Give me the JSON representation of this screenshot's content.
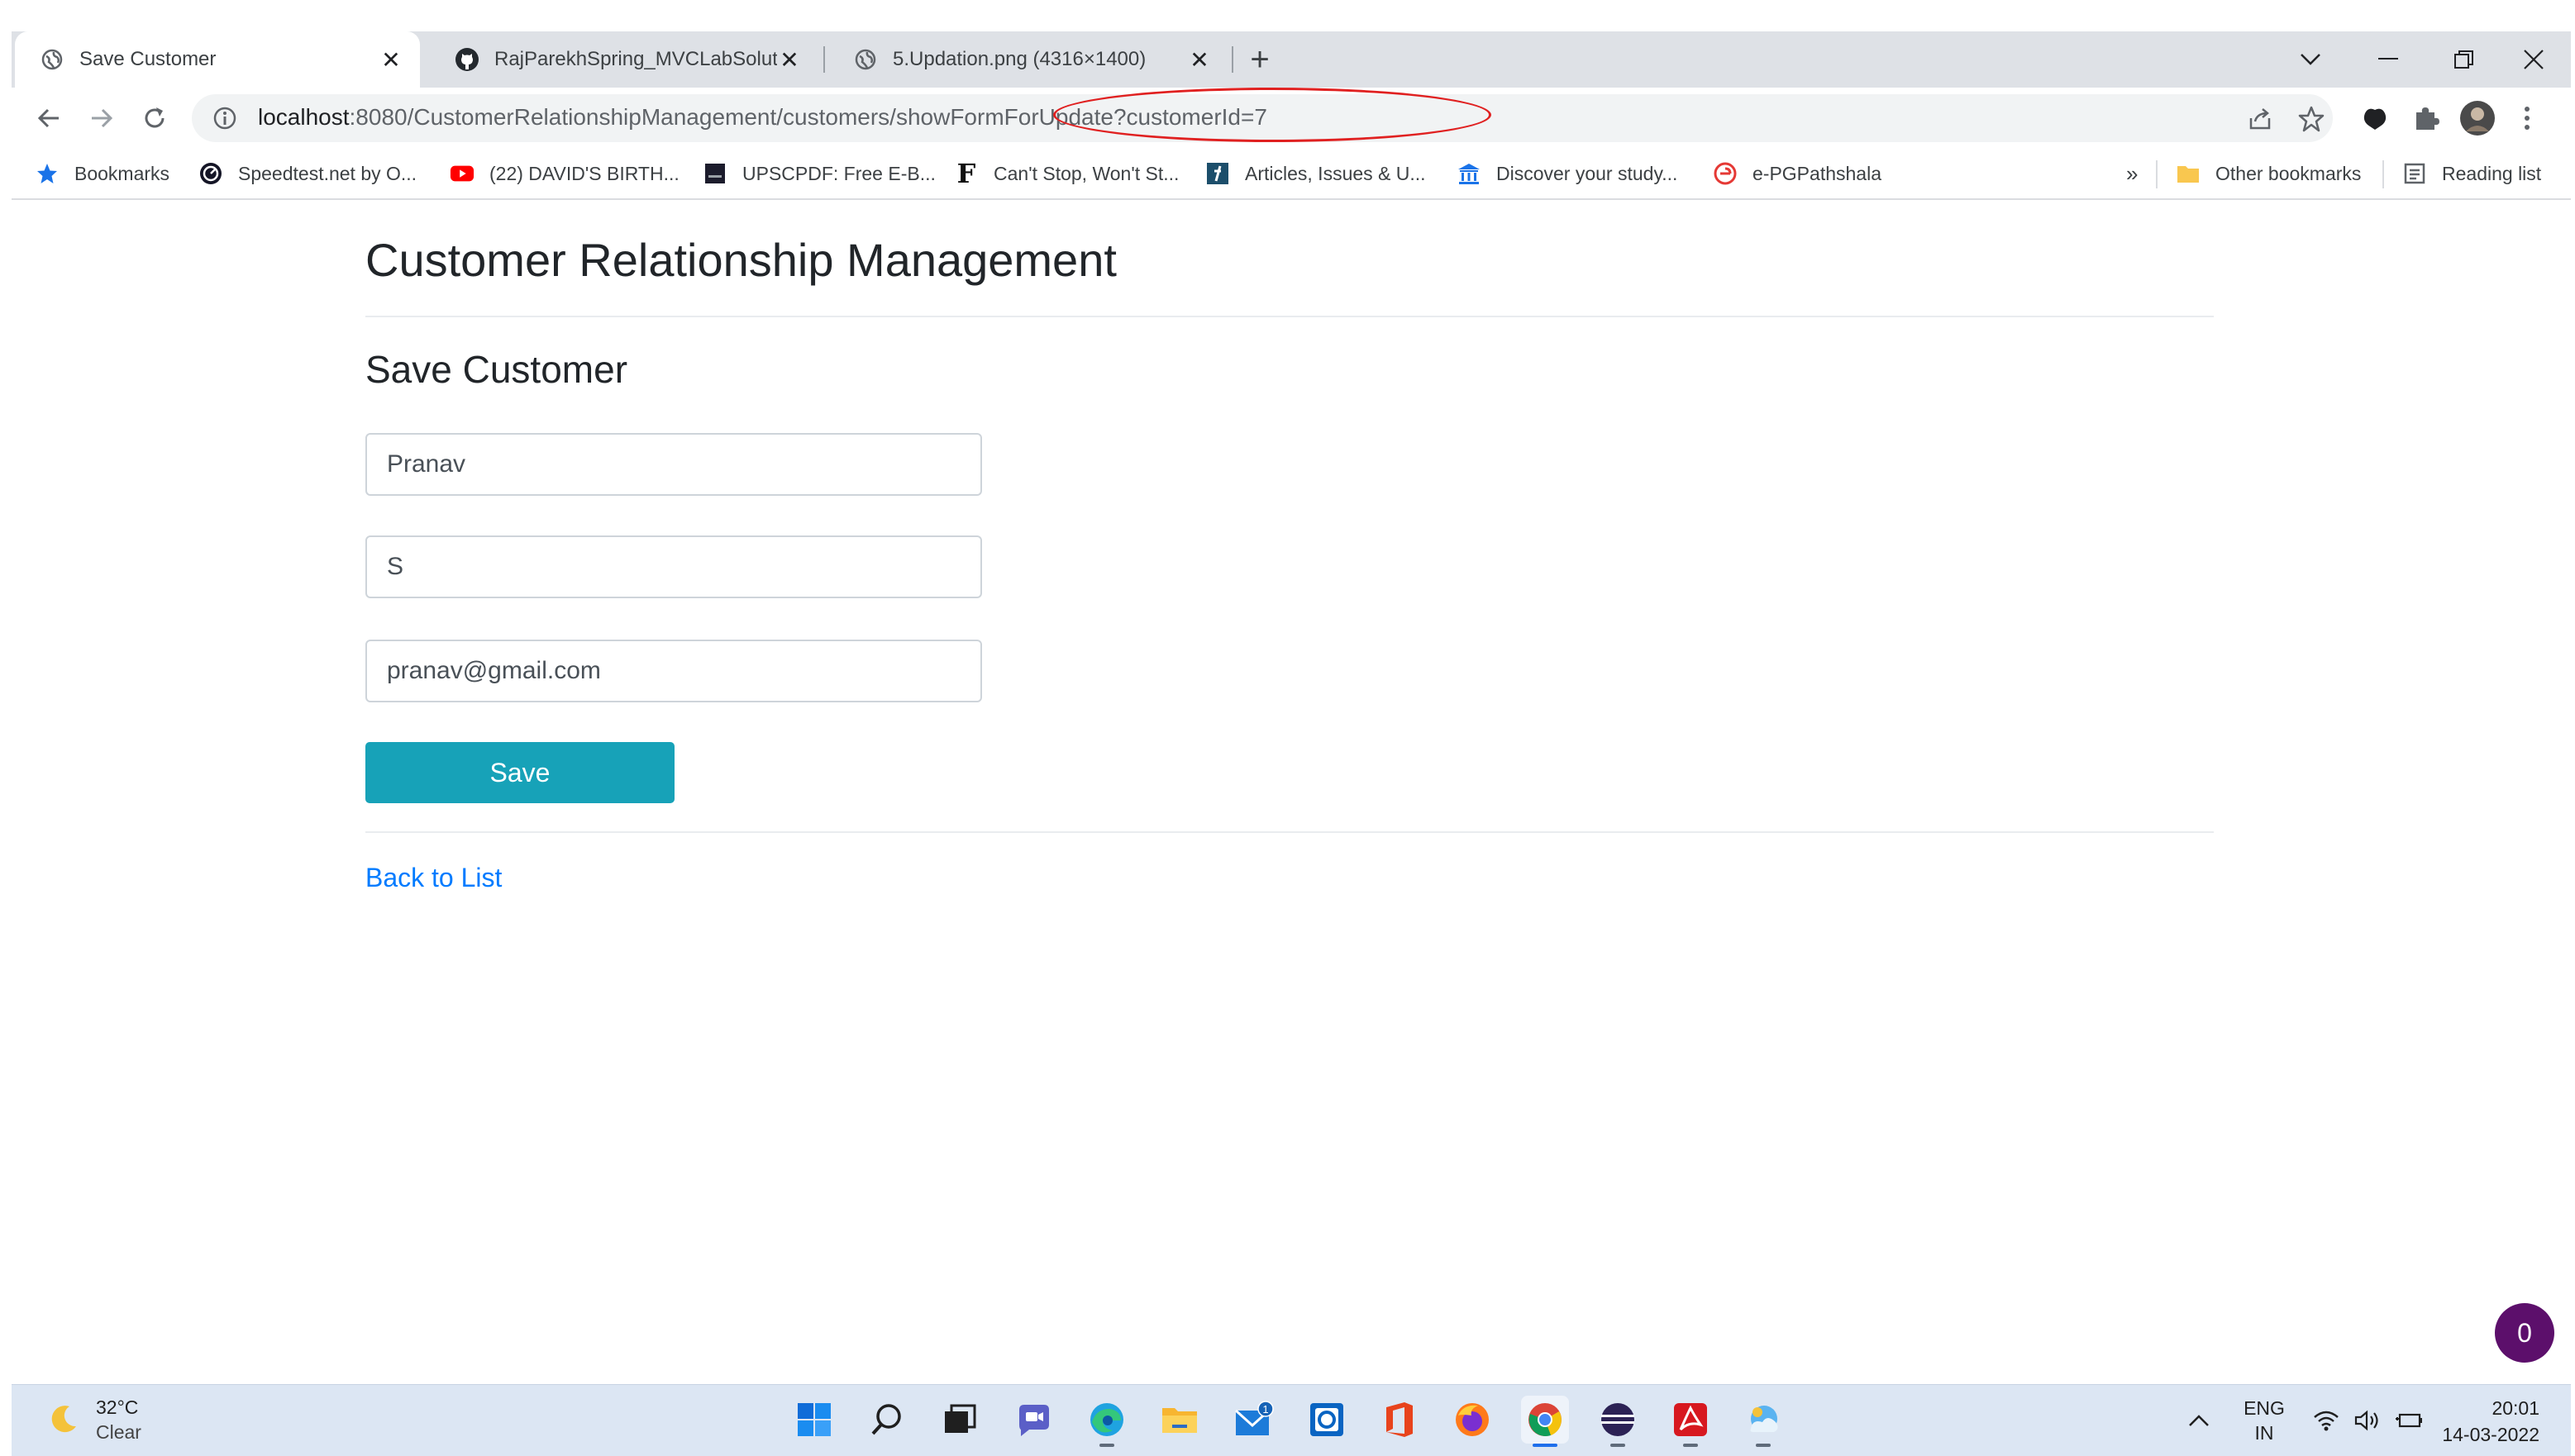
{
  "browser": {
    "tabs": [
      {
        "title": "Save Customer",
        "favicon": "globe-icon",
        "active": true
      },
      {
        "title": "RajParekhSpring_MVCLabSolutio",
        "favicon": "github-icon",
        "active": false
      },
      {
        "title": "5.Updation.png (4316×1400)",
        "favicon": "globe-icon",
        "active": false
      }
    ],
    "url_host": "localhost",
    "url_path": ":8080/CustomerRelationshipManagement/customers/showFormForUpdate?customerId=7",
    "bookmarks": [
      {
        "label": "Bookmarks",
        "icon": "star-icon"
      },
      {
        "label": "Speedtest.net by O...",
        "icon": "speedtest-icon"
      },
      {
        "label": "(22) DAVID'S BIRTH...",
        "icon": "youtube-icon"
      },
      {
        "label": "UPSCPDF: Free E-B...",
        "icon": "upscpdf-icon"
      },
      {
        "label": "Can't Stop, Won't St...",
        "icon": "f-letter-icon"
      },
      {
        "label": "Articles, Issues & U...",
        "icon": "journal-icon"
      },
      {
        "label": "Discover your study...",
        "icon": "institution-icon"
      },
      {
        "label": "e-PGPathshala",
        "icon": "epg-icon"
      }
    ],
    "bookmarks_overflow": "»",
    "other_bookmarks": "Other bookmarks",
    "reading_list": "Reading list",
    "accent_color": "#17a2b8"
  },
  "page": {
    "title": "Customer Relationship Management",
    "subtitle": "Save Customer",
    "form": {
      "first_name": "Pranav",
      "last_name": "S",
      "email": "pranav@gmail.com",
      "save_label": "Save"
    },
    "back_link": "Back to List",
    "badge_count": "0"
  },
  "taskbar": {
    "weather_temp": "32°C",
    "weather_desc": "Clear",
    "language_line1": "ENG",
    "language_line2": "IN",
    "time": "20:01",
    "date": "14-03-2022",
    "mail_badge": "1"
  }
}
